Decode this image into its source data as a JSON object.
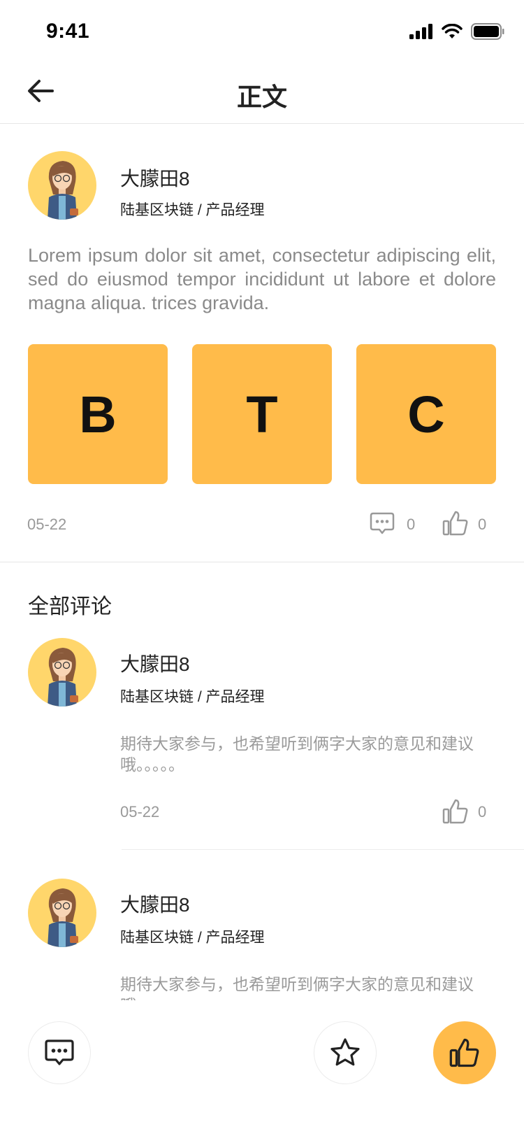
{
  "status_bar": {
    "time": "9:41"
  },
  "nav": {
    "title": "正文"
  },
  "post": {
    "author": {
      "name": "大朦田8",
      "role": "陆基区块链 / 产品经理"
    },
    "text": "Lorem ipsum dolor sit amet, consectetur adipiscing elit, sed do eiusmod tempor incididunt ut labore et dolore magna aliqua. trices gravida.",
    "tiles": [
      "B",
      "T",
      "C"
    ],
    "date": "05-22",
    "comment_count": "0",
    "like_count": "0"
  },
  "comments_section": {
    "title": "全部评论",
    "items": [
      {
        "name": "大朦田8",
        "role": "陆基区块链 / 产品经理",
        "text": "期待大家参与，也希望听到俩字大家的意见和建议哦。。。。。",
        "date": "05-22",
        "like_count": "0"
      },
      {
        "name": "大朦田8",
        "role": "陆基区块链 / 产品经理",
        "text": "期待大家参与，也希望听到俩字大家的意见和建议哦。。。。。"
      }
    ]
  },
  "colors": {
    "accent": "#ffbb4a",
    "avatar_bg": "#ffd66b",
    "muted_text": "#999999"
  },
  "icons": [
    "signal-icon",
    "wifi-icon",
    "battery-icon",
    "back-arrow-icon",
    "comment-icon",
    "thumbs-up-icon",
    "star-icon"
  ]
}
